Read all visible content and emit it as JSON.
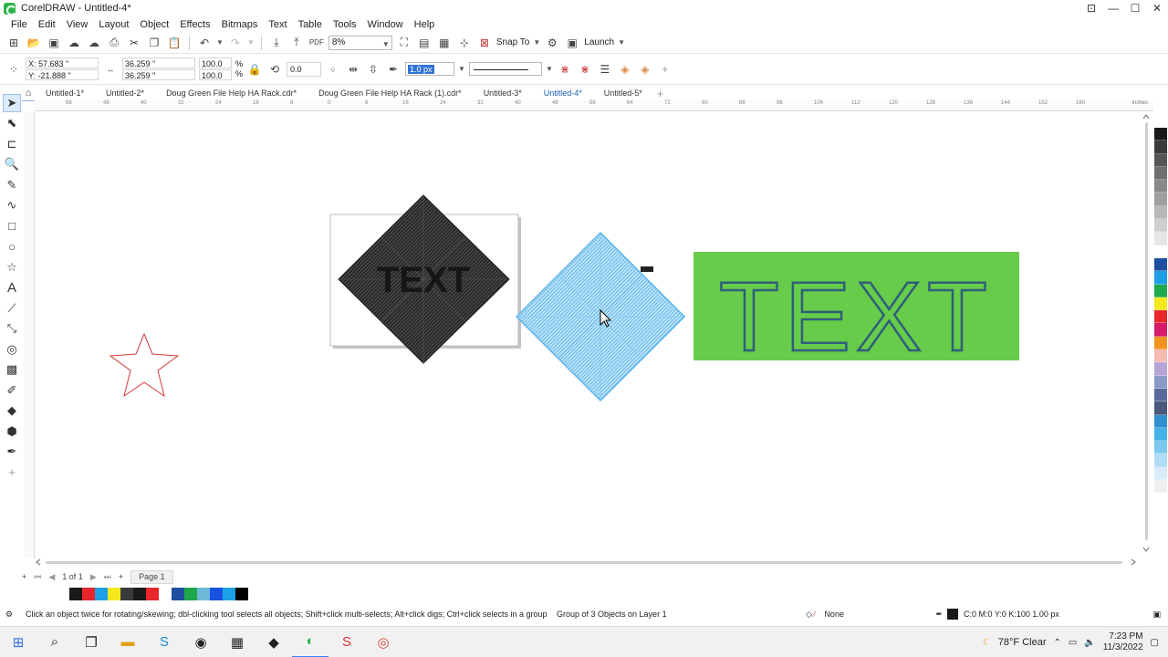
{
  "window": {
    "title": "CorelDRAW - Untitled-4*",
    "controls": [
      "⊡",
      "—",
      "☐",
      "✕"
    ]
  },
  "menu": [
    "File",
    "Edit",
    "View",
    "Layout",
    "Object",
    "Effects",
    "Bitmaps",
    "Text",
    "Table",
    "Tools",
    "Window",
    "Help"
  ],
  "toolbar": {
    "zoom_value": "8%",
    "snap_label": "Snap To",
    "launch_label": "Launch"
  },
  "property_bar": {
    "x": "X: 57.683 \"",
    "y": "Y: -21.888 \"",
    "width": "36.259 \"",
    "height": "36.259 \"",
    "scale_w": "100.0",
    "scale_h": "100.0",
    "percent": "%",
    "angle": "0.0",
    "outline_width": "1.0 px"
  },
  "tabs": [
    {
      "label": "Untitled-1*",
      "active": false
    },
    {
      "label": "Untitled-2*",
      "active": false
    },
    {
      "label": "Doug Green File Help HA Rack.cdr*",
      "active": false
    },
    {
      "label": "Doug Green File Help HA Rack (1).cdr*",
      "active": false
    },
    {
      "label": "Untitled-3*",
      "active": false
    },
    {
      "label": "Untitled-4*",
      "active": true
    },
    {
      "label": "Untitled-5*",
      "active": false
    }
  ],
  "ruler": {
    "h_ticks": [
      "56",
      "48",
      "40",
      "32",
      "24",
      "16",
      "8",
      "0",
      "8",
      "16",
      "24",
      "32",
      "40",
      "48",
      "56",
      "64",
      "72",
      "80",
      "88",
      "96",
      "104",
      "112",
      "120",
      "128",
      "136",
      "144",
      "152",
      "160"
    ],
    "unit": "inches"
  },
  "canvas": {
    "text_label": "TEXT",
    "text_fill": "#66cc4a",
    "blue_diamond": "#8fd0f2",
    "star_color": "#d23a3a"
  },
  "page_nav": {
    "page_count": "1  of  1",
    "page_label": "Page 1"
  },
  "palette_v": [
    "#1a1a1a",
    "#3b3b3b",
    "#565656",
    "#6f6f6f",
    "#888888",
    "#a0a0a0",
    "#b8b8b8",
    "#cfcfcf",
    "#e6e6e6",
    "#ffffff",
    "#1f4fa0",
    "#1ea0e6",
    "#20a84c",
    "#f5e81c",
    "#e8262b",
    "#d81a6a",
    "#f2941c",
    "#f5b9b3",
    "#b7a5d8",
    "#8b9bc8",
    "#5a6a9a",
    "#4a5a7a",
    "#2f8fd0",
    "#46b3e6",
    "#7cc8ee",
    "#b0dcf4",
    "#d7ecf8",
    "#efefef"
  ],
  "doc_palette": [
    "#1a1a1a",
    "#e8262b",
    "#1ea0e6",
    "#f5e81c",
    "#3b3b3b",
    "#1a1a1a",
    "#e8262b",
    "#ffffff",
    "#1f4fa0",
    "#20a84c",
    "#6fb8d8",
    "#1a50e0",
    "#1ea0e6",
    "#000000"
  ],
  "status": {
    "hint": "Click an object twice for rotating/skewing; dbl-clicking tool selects all objects; Shift+click multi-selects; Alt+click digs; Ctrl+click selects in a group",
    "selection": "Group of 3 Objects on Layer 1",
    "fill": "None",
    "outline": "C:0 M:0 Y:0 K:100   1.00 px"
  },
  "taskbar": {
    "weather": "78°F  Clear",
    "time": "7:23 PM",
    "date": "11/3/2022"
  }
}
